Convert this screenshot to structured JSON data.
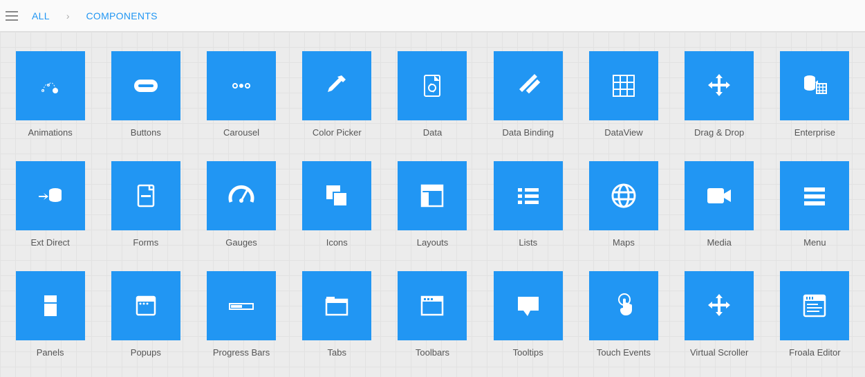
{
  "breadcrumbs": {
    "root": "ALL",
    "current": "COMPONENTS"
  },
  "colors": {
    "tile_bg": "#2196f3",
    "icon_fill": "#ffffff",
    "link": "#2196f3"
  },
  "tiles": [
    {
      "id": "animations",
      "label": "Animations",
      "icon": "animations-icon"
    },
    {
      "id": "buttons",
      "label": "Buttons",
      "icon": "buttons-icon"
    },
    {
      "id": "carousel",
      "label": "Carousel",
      "icon": "carousel-icon"
    },
    {
      "id": "colorpicker",
      "label": "Color Picker",
      "icon": "color-picker-icon"
    },
    {
      "id": "data",
      "label": "Data",
      "icon": "data-icon"
    },
    {
      "id": "databinding",
      "label": "Data Binding",
      "icon": "data-binding-icon"
    },
    {
      "id": "dataview",
      "label": "DataView",
      "icon": "dataview-icon"
    },
    {
      "id": "dragdrop",
      "label": "Drag & Drop",
      "icon": "drag-drop-icon"
    },
    {
      "id": "enterprise",
      "label": "Enterprise",
      "icon": "enterprise-icon"
    },
    {
      "id": "extdirect",
      "label": "Ext Direct",
      "icon": "ext-direct-icon"
    },
    {
      "id": "forms",
      "label": "Forms",
      "icon": "forms-icon"
    },
    {
      "id": "gauges",
      "label": "Gauges",
      "icon": "gauges-icon"
    },
    {
      "id": "icons",
      "label": "Icons",
      "icon": "icons-icon"
    },
    {
      "id": "layouts",
      "label": "Layouts",
      "icon": "layouts-icon"
    },
    {
      "id": "lists",
      "label": "Lists",
      "icon": "lists-icon"
    },
    {
      "id": "maps",
      "label": "Maps",
      "icon": "maps-icon"
    },
    {
      "id": "media",
      "label": "Media",
      "icon": "media-icon"
    },
    {
      "id": "menu",
      "label": "Menu",
      "icon": "menu-icon"
    },
    {
      "id": "panels",
      "label": "Panels",
      "icon": "panels-icon"
    },
    {
      "id": "popups",
      "label": "Popups",
      "icon": "popups-icon"
    },
    {
      "id": "progress",
      "label": "Progress Bars",
      "icon": "progress-icon"
    },
    {
      "id": "tabs",
      "label": "Tabs",
      "icon": "tabs-icon"
    },
    {
      "id": "toolbars",
      "label": "Toolbars",
      "icon": "toolbars-icon"
    },
    {
      "id": "tooltips",
      "label": "Tooltips",
      "icon": "tooltips-icon"
    },
    {
      "id": "touch",
      "label": "Touch Events",
      "icon": "touch-icon"
    },
    {
      "id": "vscroller",
      "label": "Virtual Scroller",
      "icon": "virtual-scroller-icon"
    },
    {
      "id": "froala",
      "label": "Froala Editor",
      "icon": "froala-icon"
    }
  ]
}
